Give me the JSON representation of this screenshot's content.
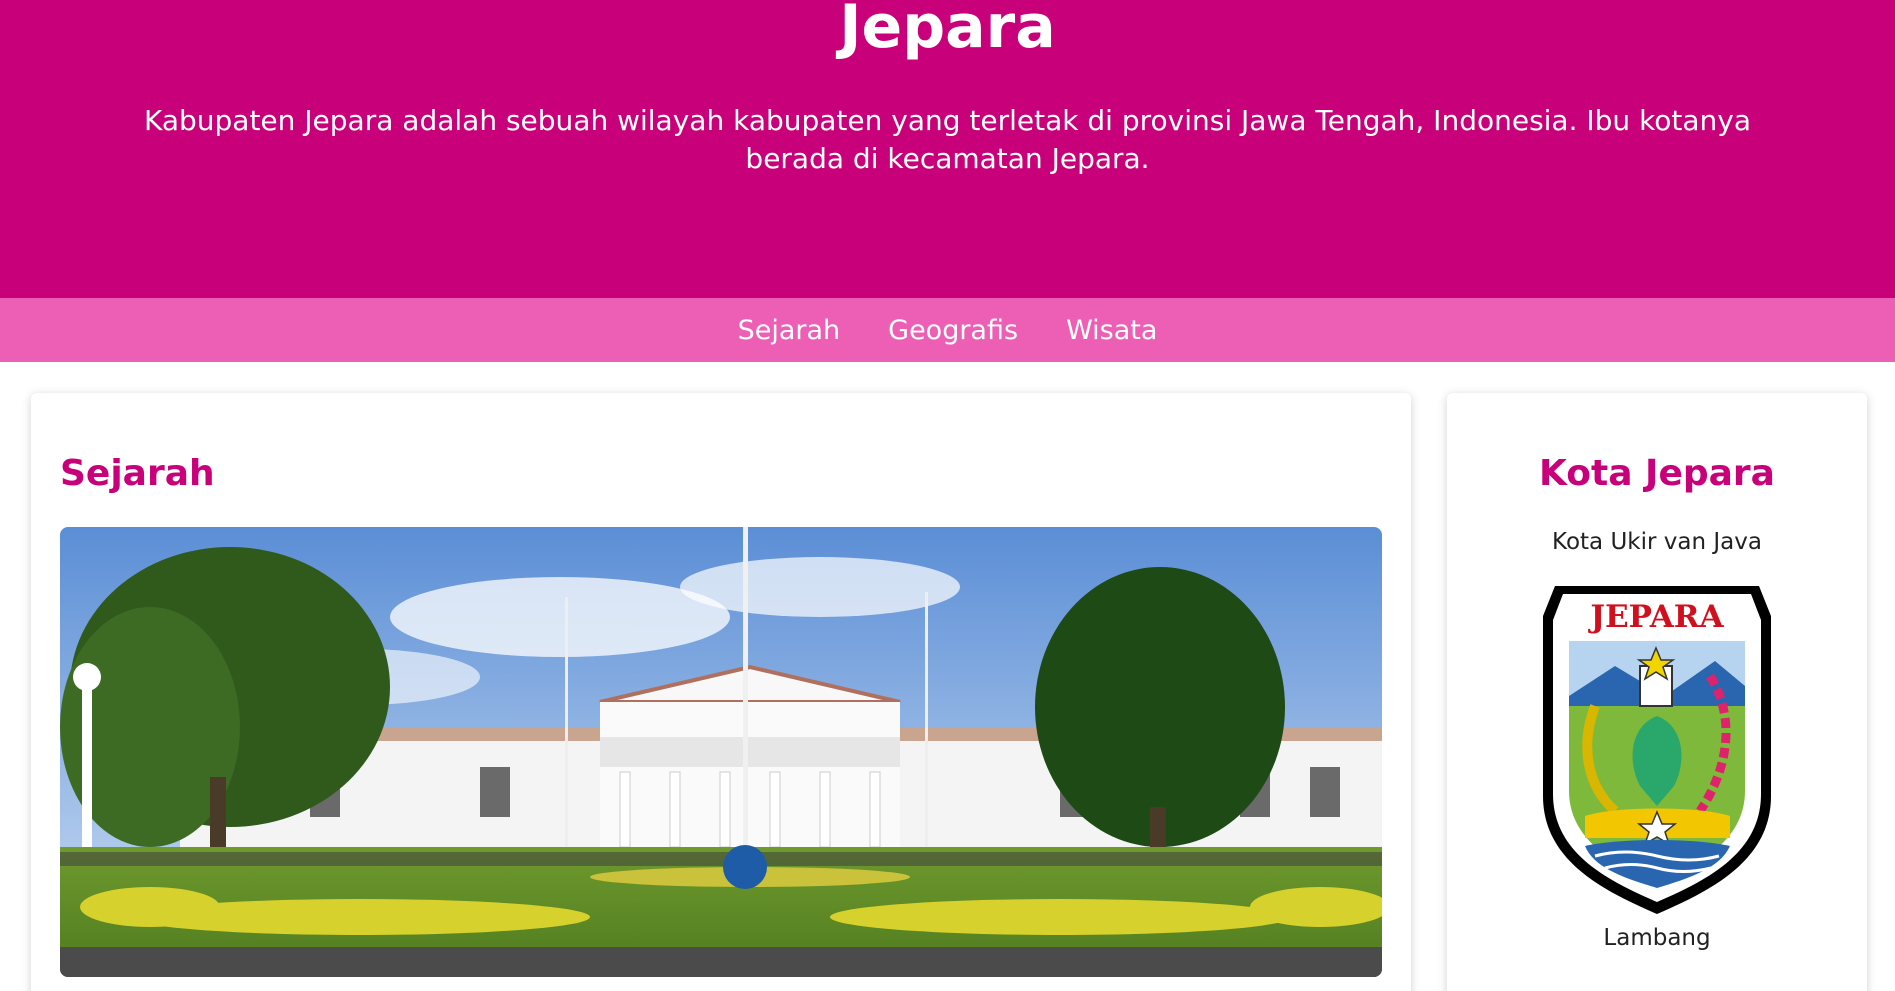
{
  "header": {
    "title": "Jepara",
    "description": "Kabupaten Jepara adalah sebuah wilayah kabupaten yang terletak di provinsi Jawa Tengah, Indonesia. Ibu kotanya berada di kecamatan Jepara."
  },
  "nav": {
    "items": [
      "Sejarah",
      "Geografis",
      "Wisata"
    ]
  },
  "main": {
    "section_title": "Sejarah"
  },
  "sidebar": {
    "title": "Kota Jepara",
    "motto": "Kota Ukir van Java",
    "crest_text": "JEPARA",
    "crest_caption": "Lambang"
  },
  "colors": {
    "header_bg": "#c8007a",
    "nav_bg": "#ec5fb5",
    "accent": "#c8007a"
  }
}
